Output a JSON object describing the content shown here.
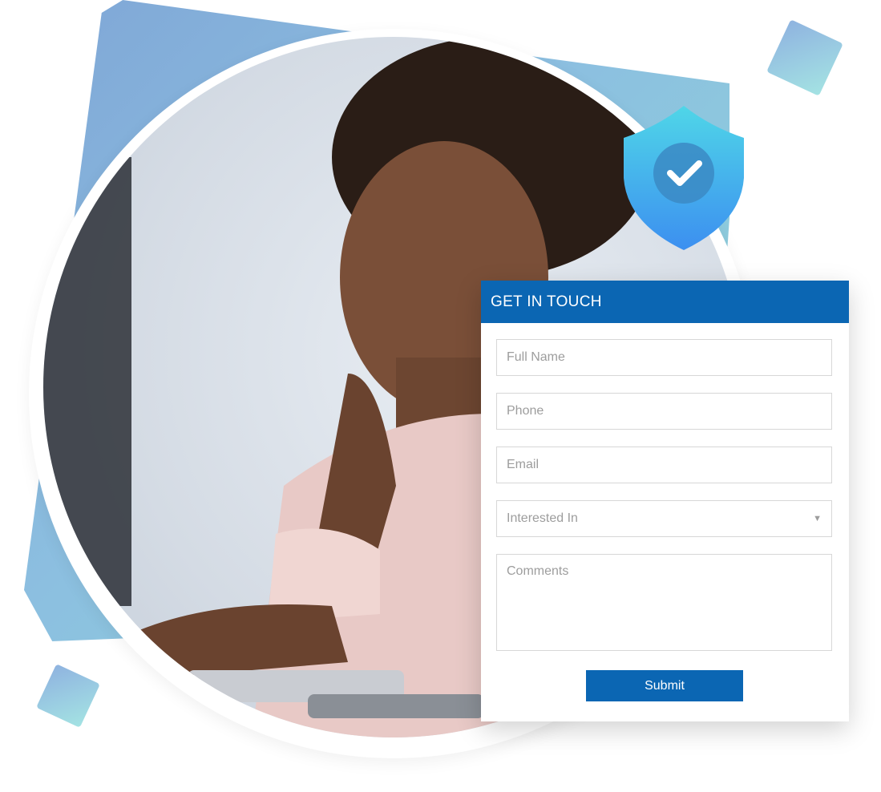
{
  "form": {
    "title": "GET IN TOUCH",
    "full_name_placeholder": "Full Name",
    "phone_placeholder": "Phone",
    "email_placeholder": "Email",
    "interested_in_placeholder": "Interested In",
    "comments_placeholder": "Comments",
    "submit_label": "Submit"
  },
  "colors": {
    "primary": "#0b66b3",
    "shield_top": "#4fd6e8",
    "shield_bottom": "#3c8ff0",
    "background_shape": "#8cbfe0"
  },
  "icons": {
    "shield": "shield-check-icon",
    "dropdown": "caret-down-icon"
  }
}
